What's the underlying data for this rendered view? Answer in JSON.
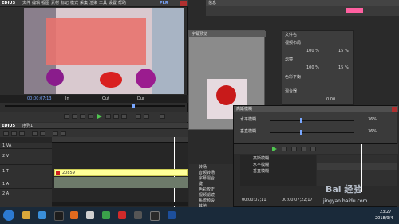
{
  "player": {
    "logo": "EDIUS",
    "menu": [
      "文件",
      "编辑",
      "视图",
      "素材",
      "标记",
      "模式",
      "采集",
      "渲染",
      "工具",
      "设置",
      "帮助"
    ],
    "mode": "PLR",
    "timecodes": {
      "current": "00:00:07;13",
      "in": "In",
      "out": "Out",
      "dur": "Dur"
    }
  },
  "timeline": {
    "logo": "EDIUS",
    "sequence": "序列1",
    "clip_label": "20859",
    "tracks": [
      "1 VA",
      "2 V",
      "1 T",
      "1 A",
      "2 A"
    ]
  },
  "info_panel": {
    "title": "信息",
    "lines": [
      "文件名",
      "视频布局",
      "",
      "滤镜",
      "",
      "色彩平衡",
      "",
      "混合器"
    ],
    "values": [
      "100 %",
      "15 %",
      "0.00",
      "",
      "100 %",
      "15 %",
      "0.00",
      ""
    ]
  },
  "preview_win": {
    "title": "字幕预览"
  },
  "filter_dialog": {
    "title": "高斯模糊",
    "h_label": "水平模糊",
    "v_label": "垂直模糊",
    "h_value": "36%",
    "v_value": "36%",
    "h_level": 0.36,
    "v_level": 0.36
  },
  "effects": {
    "tree": [
      "高斯模糊",
      "水平模糊",
      "垂直模糊"
    ],
    "list": [
      "转场",
      "音频转场",
      "字幕混合",
      "键",
      "色彩校正",
      "视频滤镜",
      "系统预设",
      "其他"
    ],
    "timecode": "00:00:07;11",
    "timecode2": "00:00:07;22;17"
  },
  "taskbar": {
    "time": "23:27",
    "date": "2018/9/4",
    "watermark": "jingyan.baidu.com",
    "watermark_logo": "Bai 经验"
  },
  "colors": {
    "accent": "#79a7ff",
    "panel": "#3c3c3c",
    "dark": "#1f1f1f",
    "highlight": "#ffff99",
    "green": "#50c850"
  }
}
